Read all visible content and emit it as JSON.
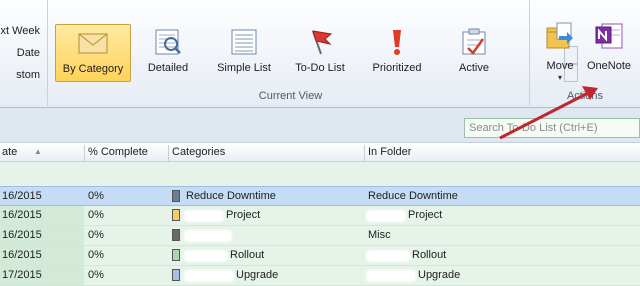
{
  "ribbon": {
    "arrange_items": [
      "xt Week",
      "Date",
      "stom"
    ],
    "current_view": {
      "group_label": "Current View",
      "views": [
        {
          "label": "By Category",
          "active": true
        },
        {
          "label": "Detailed",
          "active": false
        },
        {
          "label": "Simple List",
          "active": false
        },
        {
          "label": "To-Do List",
          "active": false
        },
        {
          "label": "Prioritized",
          "active": false
        },
        {
          "label": "Active",
          "active": false
        }
      ]
    },
    "actions": {
      "group_label": "Actions",
      "move_label": "Move",
      "onenote_label": "OneNote"
    }
  },
  "search": {
    "placeholder": "Search To-Do List (Ctrl+E)"
  },
  "table": {
    "columns": [
      "ate",
      "% Complete",
      "Categories",
      "In Folder"
    ],
    "rows": [
      {
        "date": "16/2015",
        "percent": "0%",
        "category": "Reduce Downtime",
        "folder": "Reduce Downtime",
        "color": "#6b7c93",
        "selected": true
      },
      {
        "date": "16/2015",
        "percent": "0%",
        "category": "Project",
        "folder": "Project",
        "color": "#f3cd6a",
        "selected": false
      },
      {
        "date": "16/2015",
        "percent": "0%",
        "category": "",
        "folder": "Misc",
        "color": "#6a6a6a",
        "selected": false
      },
      {
        "date": "16/2015",
        "percent": "0%",
        "category": "Rollout",
        "folder": "Rollout",
        "color": "#a9d7b4",
        "selected": false
      },
      {
        "date": "17/2015",
        "percent": "0%",
        "category": "Upgrade",
        "folder": "Upgrade",
        "color": "#a8bfe8",
        "selected": false
      }
    ]
  },
  "colors": {
    "annotation_arrow": "#c0262d",
    "selection": "#c5ddf4",
    "row_bg": "#e6f3e9"
  }
}
